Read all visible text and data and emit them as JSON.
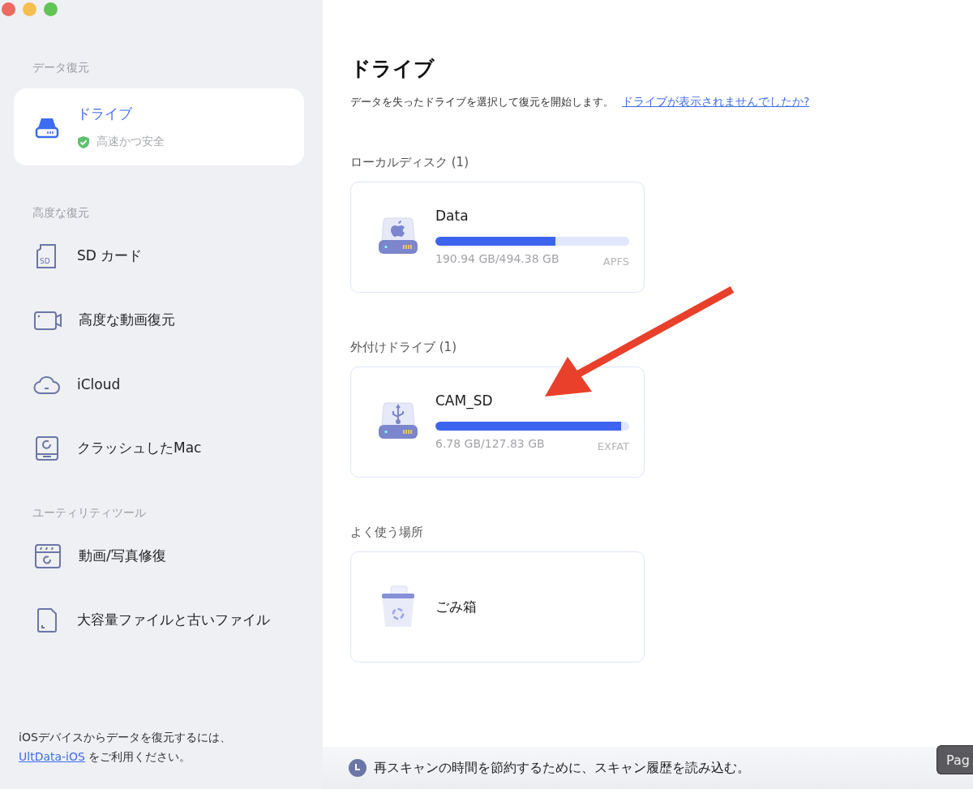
{
  "window": {
    "traffic_lights": [
      {
        "color": "#ed6a5e"
      },
      {
        "color": "#f5bf4f"
      },
      {
        "color": "#61c554"
      }
    ]
  },
  "sidebar": {
    "sections": [
      {
        "title": "データ復元",
        "items": [
          {
            "kind": "drive",
            "label": "ドライブ",
            "subtitle": "高速かつ安全",
            "selected": true
          }
        ]
      },
      {
        "title": "高度な復元",
        "items": [
          {
            "kind": "sd",
            "label": "SD カード",
            "icon_text": "SD",
            "selected": false
          },
          {
            "kind": "video",
            "label": "高度な動画復元",
            "selected": false
          },
          {
            "kind": "cloud",
            "label": "iCloud",
            "selected": false
          },
          {
            "kind": "crash",
            "label": "クラッシュしたMac",
            "selected": false
          }
        ]
      },
      {
        "title": "ユーティリティツール",
        "items": [
          {
            "kind": "repair",
            "label": "動画/写真修復",
            "selected": false
          },
          {
            "kind": "file",
            "label": "大容量ファイルと古いファイル",
            "selected": false
          }
        ]
      }
    ],
    "footer": {
      "text": "iOSデバイスからデータを復元するには、",
      "link": "UltData-iOS",
      "after": "をご利用ください。"
    }
  },
  "main": {
    "title": "ドライブ",
    "subtitle": "データを失ったドライブを選択して復元を開始します。",
    "help_link": "ドライブが表示されませんでしたか?",
    "groups": [
      {
        "title": "ローカルディスク (1)",
        "drives": [
          {
            "kind": "mac",
            "name": "Data",
            "level": 0.62,
            "size": "190.94 GB/494.38 GB",
            "format": "APFS"
          }
        ]
      },
      {
        "title": "外付けドライブ (1)",
        "drives": [
          {
            "kind": "usb",
            "name": "CAM_SD",
            "level": 0.96,
            "size": "6.78 GB/127.83 GB",
            "format": "EXFAT"
          }
        ]
      },
      {
        "title": "よく使う場所",
        "drives": [
          {
            "kind": "trash",
            "name": "ごみ箱"
          }
        ]
      }
    ],
    "status_bar": {
      "text": "再スキャンの時間を節約するために、スキャン履歴を読み込む。"
    },
    "tooltip": "Pag"
  }
}
